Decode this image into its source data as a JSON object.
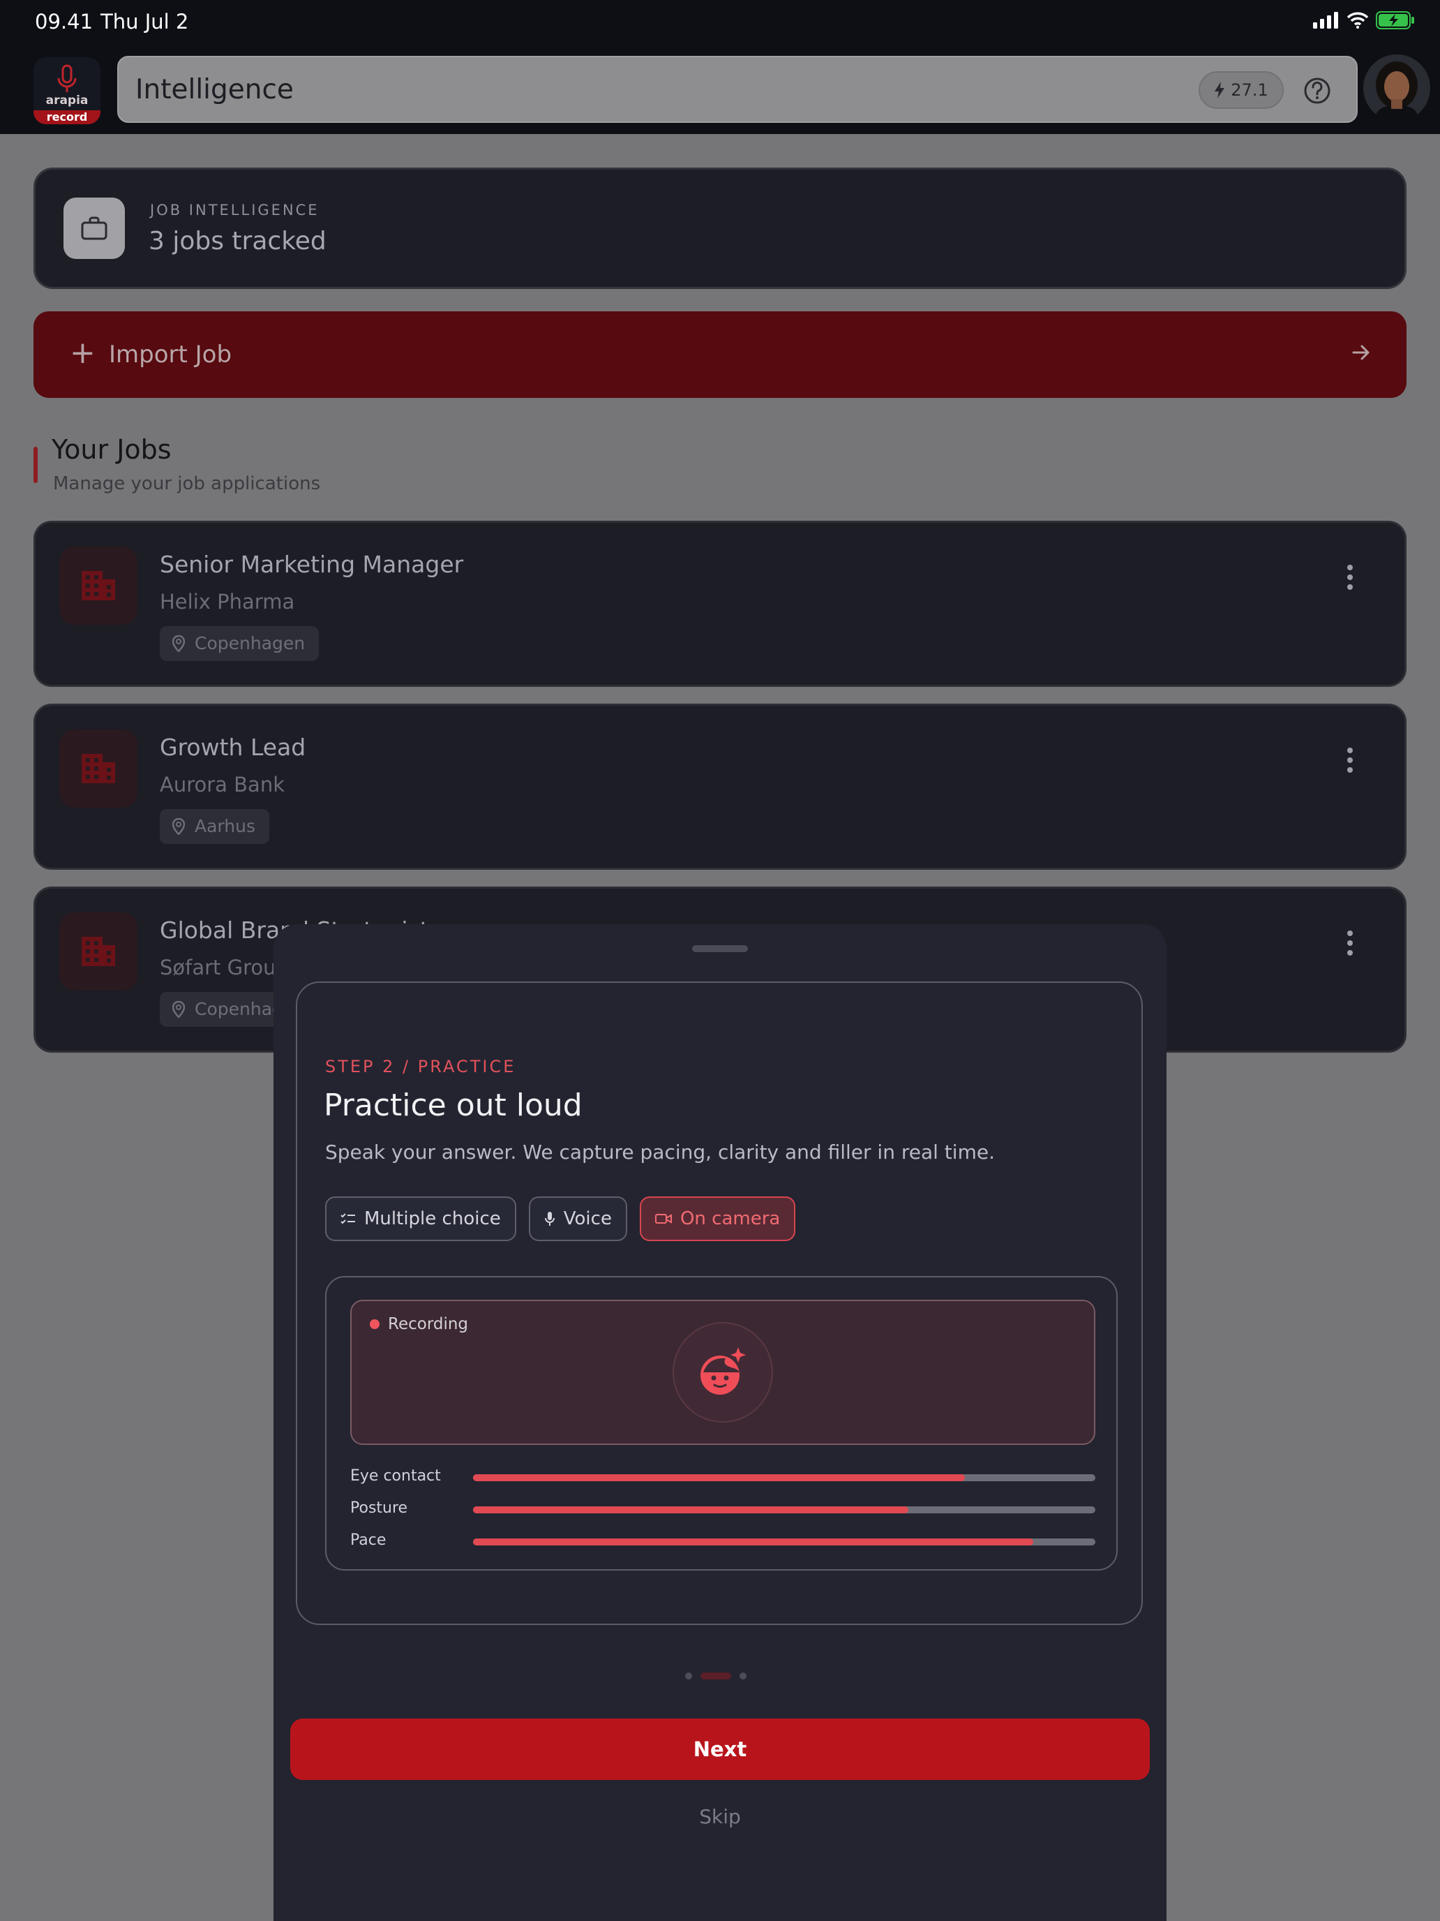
{
  "status": {
    "time": "09.41",
    "date": "Thu Jul 2"
  },
  "header": {
    "title": "Intelligence",
    "credits": "27.1",
    "logo_text_top": "arapia",
    "logo_text_bottom": "record"
  },
  "intel": {
    "kicker": "JOB INTELLIGENCE",
    "count": "3 jobs tracked"
  },
  "import": {
    "label": "Import Job"
  },
  "section": {
    "title": "Your Jobs",
    "subtitle": "Manage your job applications"
  },
  "jobs": [
    {
      "title": "Senior Marketing Manager",
      "company": "Helix Pharma",
      "location": "Copenhagen"
    },
    {
      "title": "Growth Lead",
      "company": "Aurora Bank",
      "location": "Aarhus"
    },
    {
      "title": "Global Brand Strategist",
      "company": "Søfart Group",
      "location": "Copenhagen"
    }
  ],
  "sheet": {
    "step": "STEP 2 / PRACTICE",
    "title": "Practice out loud",
    "description": "Speak your answer. We capture pacing, clarity and filler in real time.",
    "modes": [
      {
        "label": "Multiple choice",
        "icon": "checklist-icon",
        "active": false
      },
      {
        "label": "Voice",
        "icon": "microphone-icon",
        "active": false
      },
      {
        "label": "On camera",
        "icon": "video-camera-icon",
        "active": true
      }
    ],
    "recording_label": "Recording",
    "metrics": [
      {
        "label": "Eye contact",
        "value": 0.79
      },
      {
        "label": "Posture",
        "value": 0.7
      },
      {
        "label": "Pace",
        "value": 0.9
      }
    ],
    "page_indicator": {
      "current": 2,
      "total": 3
    },
    "next_label": "Next",
    "skip_label": "Skip"
  },
  "colors": {
    "accent": "#b8141b",
    "accent_light": "#e14a53",
    "sheet_bg": "#232430",
    "card_bg": "#1c1d25"
  }
}
